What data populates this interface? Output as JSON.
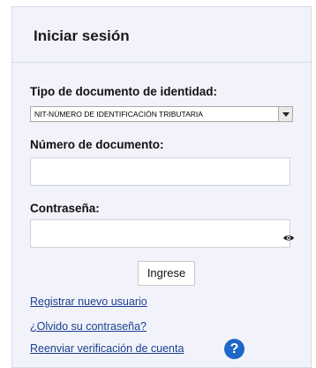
{
  "panel": {
    "title": "Iniciar sesión"
  },
  "form": {
    "doc_type_label": "Tipo de documento de identidad:",
    "doc_type_value": "NIT-NÚMERO DE IDENTIFICACIÓN TRIBUTARIA",
    "doc_number_label": "Número de documento:",
    "doc_number_value": "",
    "password_label": "Contraseña:",
    "password_value": "",
    "submit_label": "Ingrese"
  },
  "links": {
    "register": "Registrar nuevo usuario",
    "forgot": "¿Olvido su contraseña?",
    "resend": "Reenviar verificación de cuenta"
  },
  "icons": {
    "eye": "eye-icon",
    "help": "help-icon"
  },
  "colors": {
    "panel_bg": "#f2f3fa",
    "link": "#1c3f8f",
    "help_bg": "#1f67c6"
  }
}
